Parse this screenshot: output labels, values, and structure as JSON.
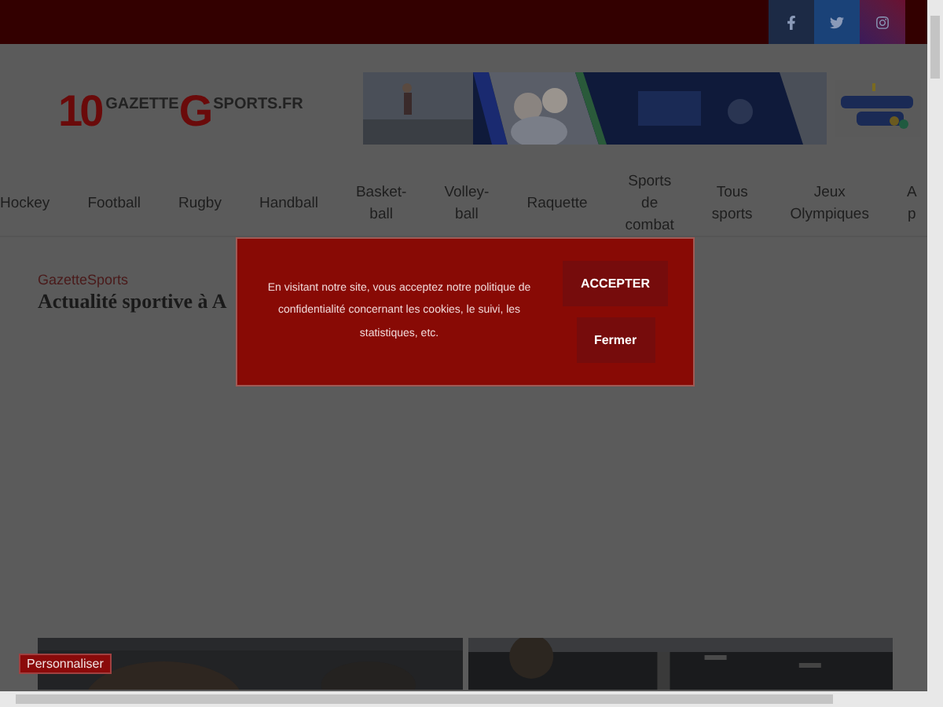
{
  "social_links": [
    {
      "kind": "facebook"
    },
    {
      "kind": "twitter"
    },
    {
      "kind": "instagram"
    }
  ],
  "logo": {
    "mark": "10",
    "word_1": "GAZETTE",
    "letter": "G",
    "word_2": "SPORTS.FR"
  },
  "nav": {
    "items": [
      {
        "lines": [
          "Hockey"
        ]
      },
      {
        "lines": [
          "Football"
        ]
      },
      {
        "lines": [
          "Rugby"
        ]
      },
      {
        "lines": [
          "Handball"
        ]
      },
      {
        "lines": [
          "Basket-",
          "ball"
        ]
      },
      {
        "lines": [
          "Volley-",
          "ball"
        ]
      },
      {
        "lines": [
          "Raquette"
        ]
      },
      {
        "lines": [
          "Sports",
          "de",
          "combat"
        ]
      },
      {
        "lines": [
          "Tous",
          "sports"
        ]
      },
      {
        "lines": [
          "Jeux",
          "Olympiques"
        ]
      },
      {
        "lines": [
          "A",
          "p"
        ]
      }
    ]
  },
  "section": {
    "kicker": "GazetteSports",
    "title": "Actualité sportive à A"
  },
  "cookie_dialog": {
    "message": "En visitant notre site, vous acceptez notre politique de confidentialité concernant les cookies, le suivi, les statistiques, etc.",
    "buttons": [
      "ACCEPTER",
      "Fermer"
    ]
  },
  "customize_button": "Personnaliser"
}
